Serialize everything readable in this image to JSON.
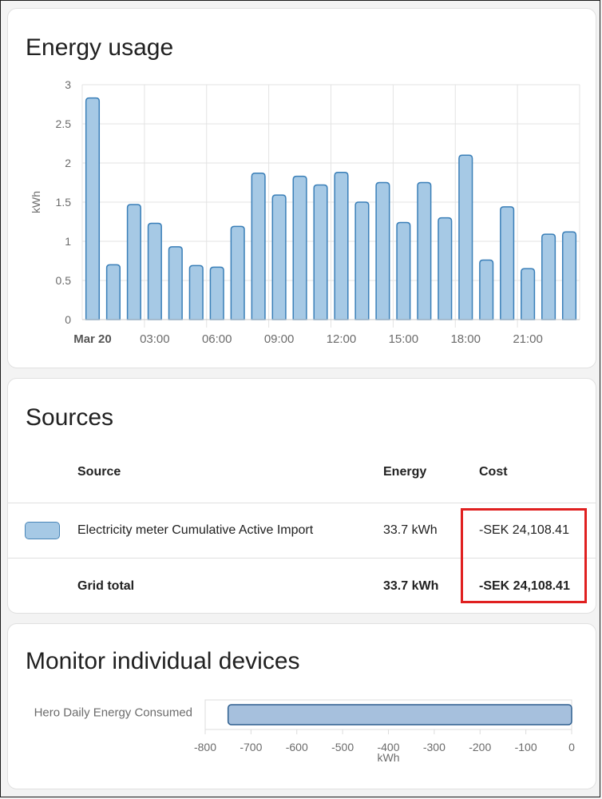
{
  "energy_card": {
    "title": "Energy usage",
    "chart_data": {
      "type": "bar",
      "ylabel": "kWh",
      "ylim": [
        0,
        3
      ],
      "yticks": [
        0,
        0.5,
        1,
        1.5,
        2,
        2.5,
        3
      ],
      "x_tick_labels": [
        {
          "label": "Mar 20",
          "hour": 0,
          "bold": true
        },
        {
          "label": "03:00",
          "hour": 3
        },
        {
          "label": "06:00",
          "hour": 6
        },
        {
          "label": "09:00",
          "hour": 9
        },
        {
          "label": "12:00",
          "hour": 12
        },
        {
          "label": "15:00",
          "hour": 15
        },
        {
          "label": "18:00",
          "hour": 18
        },
        {
          "label": "21:00",
          "hour": 21
        }
      ],
      "values": [
        2.83,
        0.7,
        1.47,
        1.23,
        0.93,
        0.69,
        0.67,
        1.19,
        1.87,
        1.59,
        1.83,
        1.72,
        1.88,
        1.5,
        1.75,
        1.24,
        1.75,
        1.3,
        2.1,
        0.76,
        1.44,
        0.65,
        1.09,
        1.12
      ],
      "bar_fill": "#a6c9e5",
      "bar_stroke": "#3a7fb8",
      "grid": true
    }
  },
  "sources_card": {
    "title": "Sources",
    "headers": {
      "source": "Source",
      "energy": "Energy",
      "cost": "Cost"
    },
    "rows": [
      {
        "source": "Electricity meter Cumulative Active Import",
        "energy": "33.7 kWh",
        "cost": "-SEK 24,108.41"
      }
    ],
    "total": {
      "label": "Grid total",
      "energy": "33.7 kWh",
      "cost": "-SEK 24,108.41"
    },
    "highlight_color": "#e02020"
  },
  "devices_card": {
    "title": "Monitor individual devices",
    "chart_data": {
      "type": "bar",
      "orientation": "horizontal",
      "categories": [
        "Hero Daily Energy Consumed"
      ],
      "values": [
        -750
      ],
      "xlabel": "kWh",
      "xlim": [
        -800,
        0
      ],
      "xticks": [
        -800,
        -700,
        -600,
        -500,
        -400,
        -300,
        -200,
        -100,
        0
      ],
      "bar_fill": "#a6c0dd",
      "bar_stroke": "#2f5f8f"
    }
  }
}
